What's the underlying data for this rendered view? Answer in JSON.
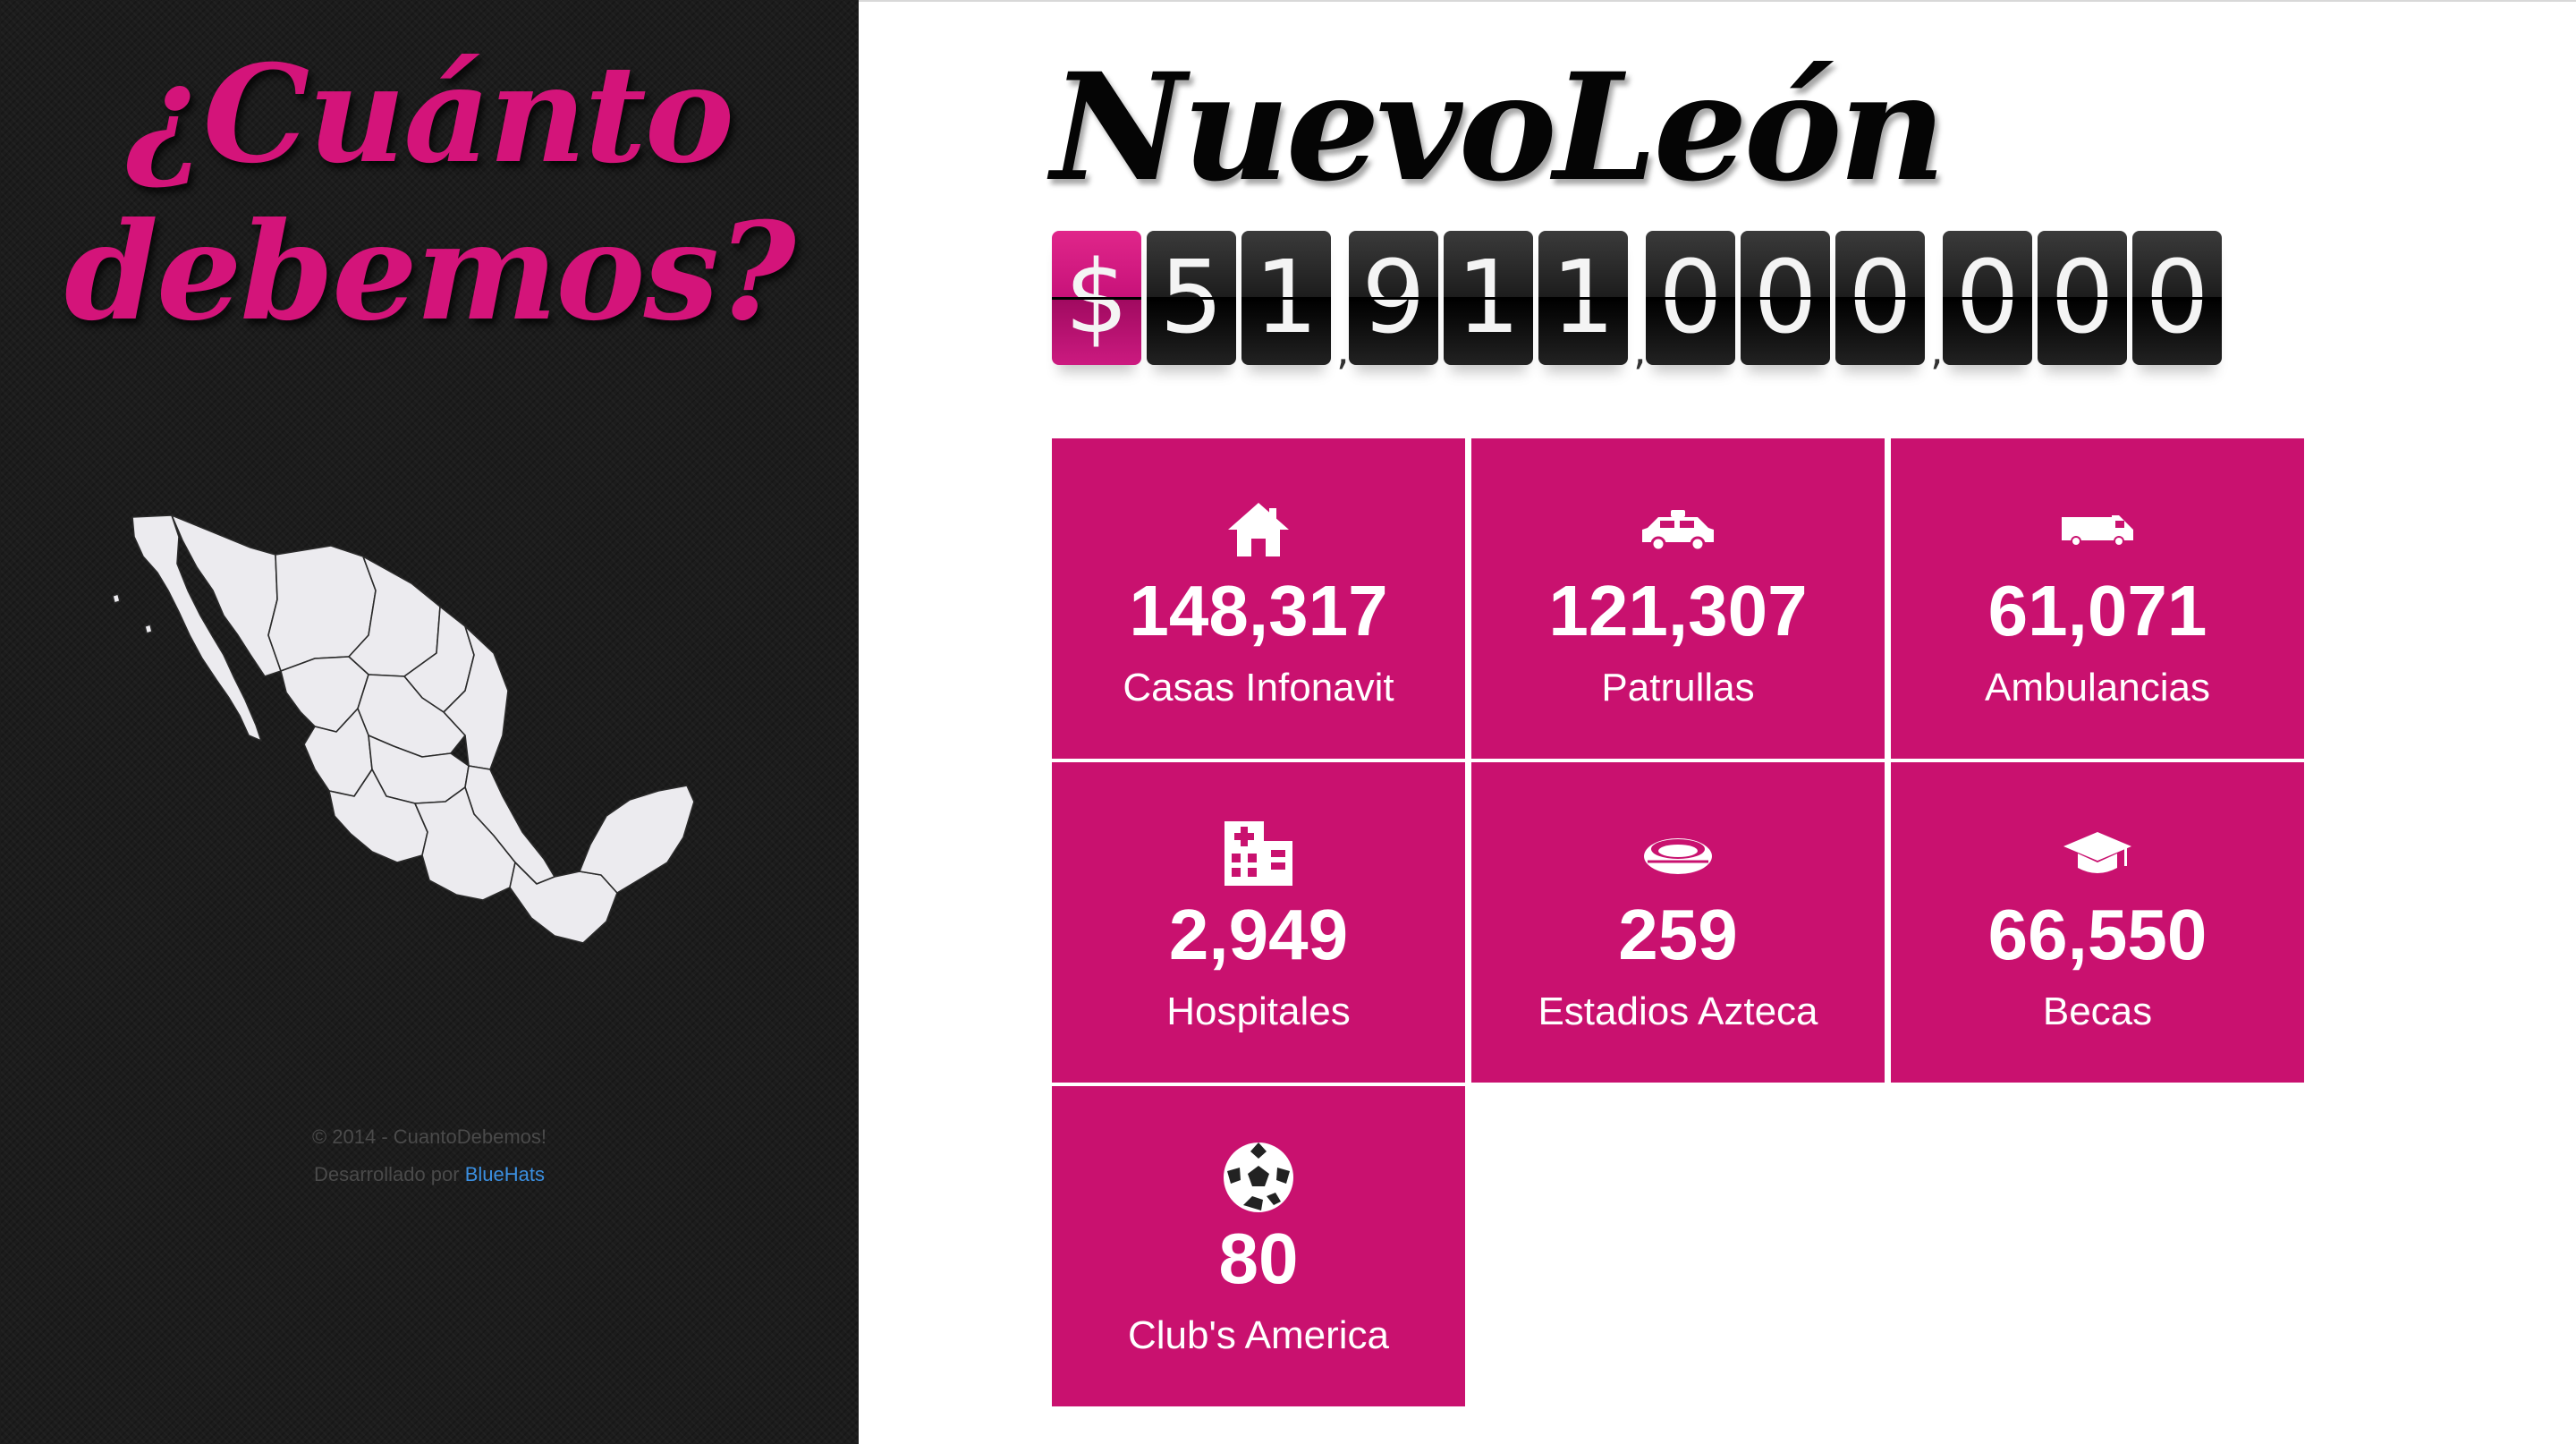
{
  "sidebar": {
    "title_line1": "¿Cuánto",
    "title_line2": "debemos?",
    "footer_copyright": "© 2014 - CuantoDebemos!",
    "footer_dev_prefix": "Desarrollado por",
    "footer_dev_link": "BlueHats"
  },
  "main": {
    "state_name": "NuevoLeón",
    "debt_currency_symbol": "$",
    "debt_digits": [
      "5",
      "1",
      "9",
      "1",
      "1",
      "0",
      "0",
      "0",
      "0",
      "0",
      "0"
    ],
    "debt_separator": ",",
    "stats": [
      {
        "value": "148,317",
        "label": "Casas Infonavit",
        "icon": "house-icon"
      },
      {
        "value": "121,307",
        "label": "Patrullas",
        "icon": "police-car-icon"
      },
      {
        "value": "61,071",
        "label": "Ambulancias",
        "icon": "ambulance-icon"
      },
      {
        "value": "2,949",
        "label": "Hospitales",
        "icon": "hospital-icon"
      },
      {
        "value": "259",
        "label": "Estadios Azteca",
        "icon": "stadium-icon"
      },
      {
        "value": "66,550",
        "label": "Becas",
        "icon": "graduation-cap-icon"
      },
      {
        "value": "80",
        "label": "Club's America",
        "icon": "soccer-ball-icon"
      }
    ]
  },
  "colors": {
    "accent": "#c9116f",
    "title_pink": "#d4147a",
    "sidebar_bg": "#1c1c1c",
    "link_blue": "#3b8fe0"
  }
}
